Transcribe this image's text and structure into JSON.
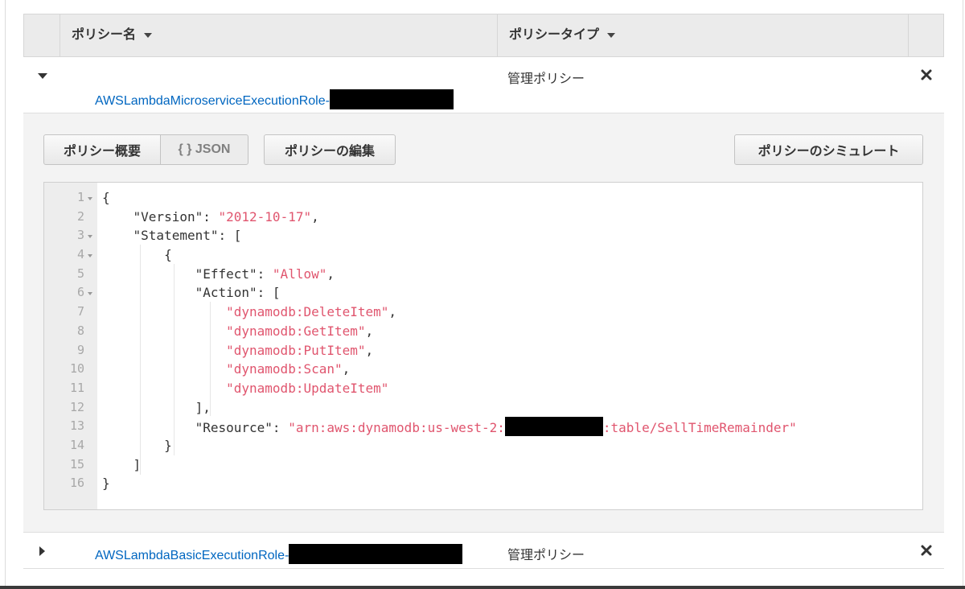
{
  "header": {
    "col_name": "ポリシー名",
    "col_type": "ポリシータイプ"
  },
  "rows": [
    {
      "name_prefix": "AWSLambdaMicroserviceExecutionRole-",
      "type": "管理ポリシー",
      "expanded": true
    },
    {
      "name_prefix": "AWSLambdaBasicExecutionRole-",
      "type": "管理ポリシー",
      "expanded": false
    }
  ],
  "detail": {
    "btn_summary": "ポリシー概要",
    "btn_json": "{ } JSON",
    "btn_edit": "ポリシーの編集",
    "btn_simulate": "ポリシーのシミュレート"
  },
  "code": {
    "l1": "{",
    "l2_key": "\"Version\"",
    "l2_val": "\"2012-10-17\"",
    "l3_key": "\"Statement\"",
    "l3_rest": ": [",
    "l4": "{",
    "l5_key": "\"Effect\"",
    "l5_val": "\"Allow\"",
    "l6_key": "\"Action\"",
    "l6_rest": ": [",
    "l7": "\"dynamodb:DeleteItem\"",
    "l8": "\"dynamodb:GetItem\"",
    "l9": "\"dynamodb:PutItem\"",
    "l10": "\"dynamodb:Scan\"",
    "l11": "\"dynamodb:UpdateItem\"",
    "l12": "],",
    "l13_key": "\"Resource\"",
    "l13_val_a": "\"arn:aws:dynamodb:us-west-2:",
    "l13_val_b": ":table/SellTimeRemainder\"",
    "l14": "}",
    "l15": "]",
    "l16": "}",
    "line_numbers": [
      "1",
      "2",
      "3",
      "4",
      "5",
      "6",
      "7",
      "8",
      "9",
      "10",
      "11",
      "12",
      "13",
      "14",
      "15",
      "16"
    ]
  },
  "colors": {
    "link": "#0066c0",
    "string": "#e0556e",
    "header_bg": "#ebebeb",
    "panel_bg": "#f3f3f3"
  },
  "icons": {
    "expanded": "caret-down-icon",
    "collapsed": "caret-right-icon",
    "sort": "sort-caret-icon",
    "remove": "close-icon"
  }
}
